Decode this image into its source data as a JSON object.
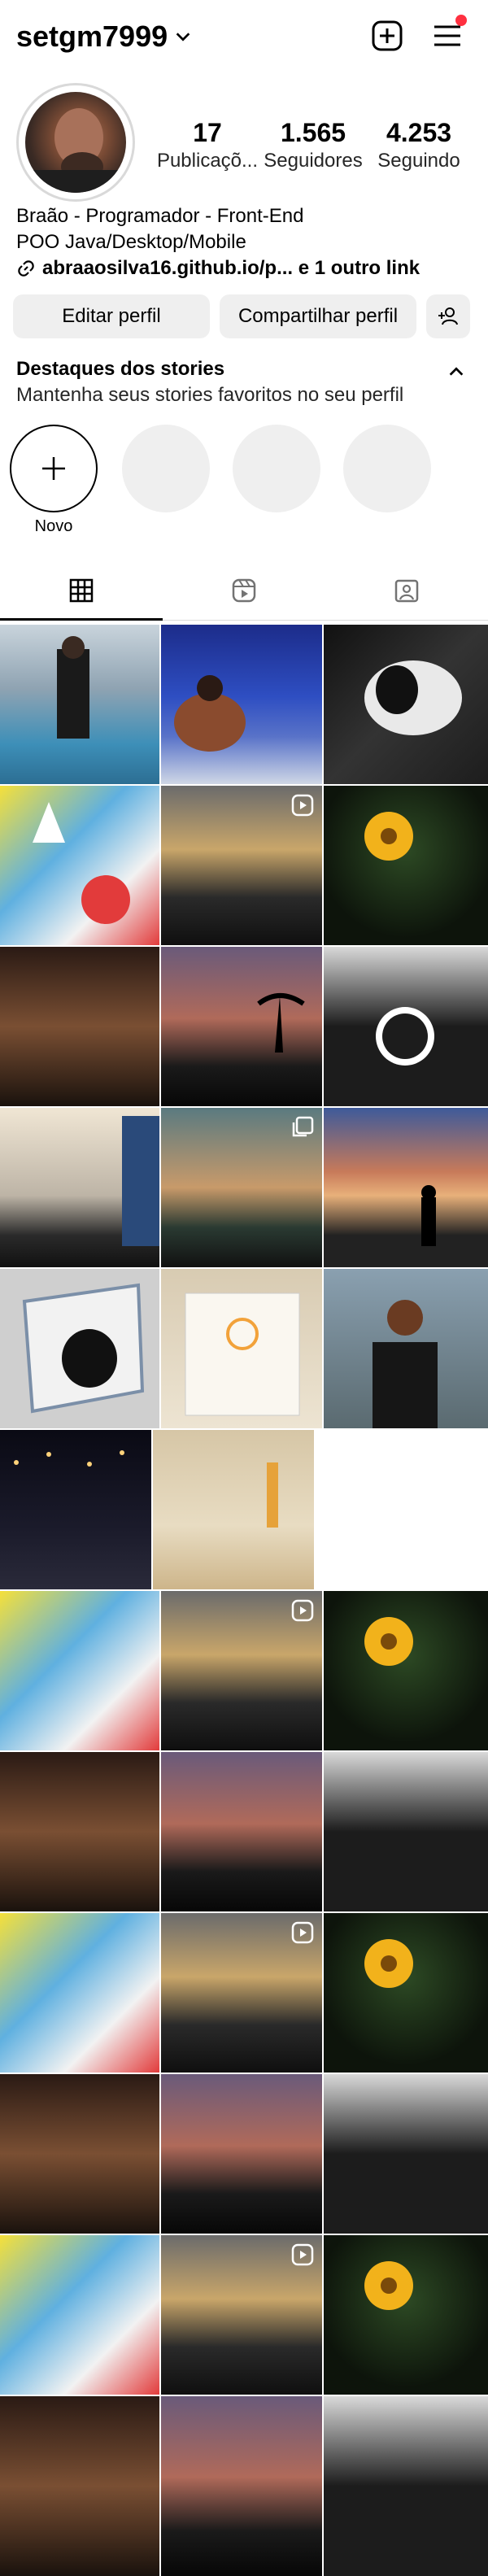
{
  "header": {
    "username": "setgm7999"
  },
  "profile": {
    "stats": [
      {
        "value": "17",
        "label": "Publicaçõ..."
      },
      {
        "value": "1.565",
        "label": "Seguidores"
      },
      {
        "value": "4.253",
        "label": "Seguindo"
      }
    ],
    "bio": {
      "name": "Braão - Programador - Front-End",
      "line2": "POO Java/Desktop/Mobile",
      "link": "abraaosilva16.github.io/p... e 1 outro link"
    }
  },
  "buttons": {
    "edit": "Editar perfil",
    "share": "Compartilhar perfil"
  },
  "highlights": {
    "title": "Destaques dos stories",
    "subtitle": "Mantenha seus stories favoritos no seu perfil",
    "new_label": "Novo"
  },
  "colors": {
    "notification_dot": "#ff3040",
    "button_bg": "#efefef",
    "story_placeholder": "#efefef"
  }
}
